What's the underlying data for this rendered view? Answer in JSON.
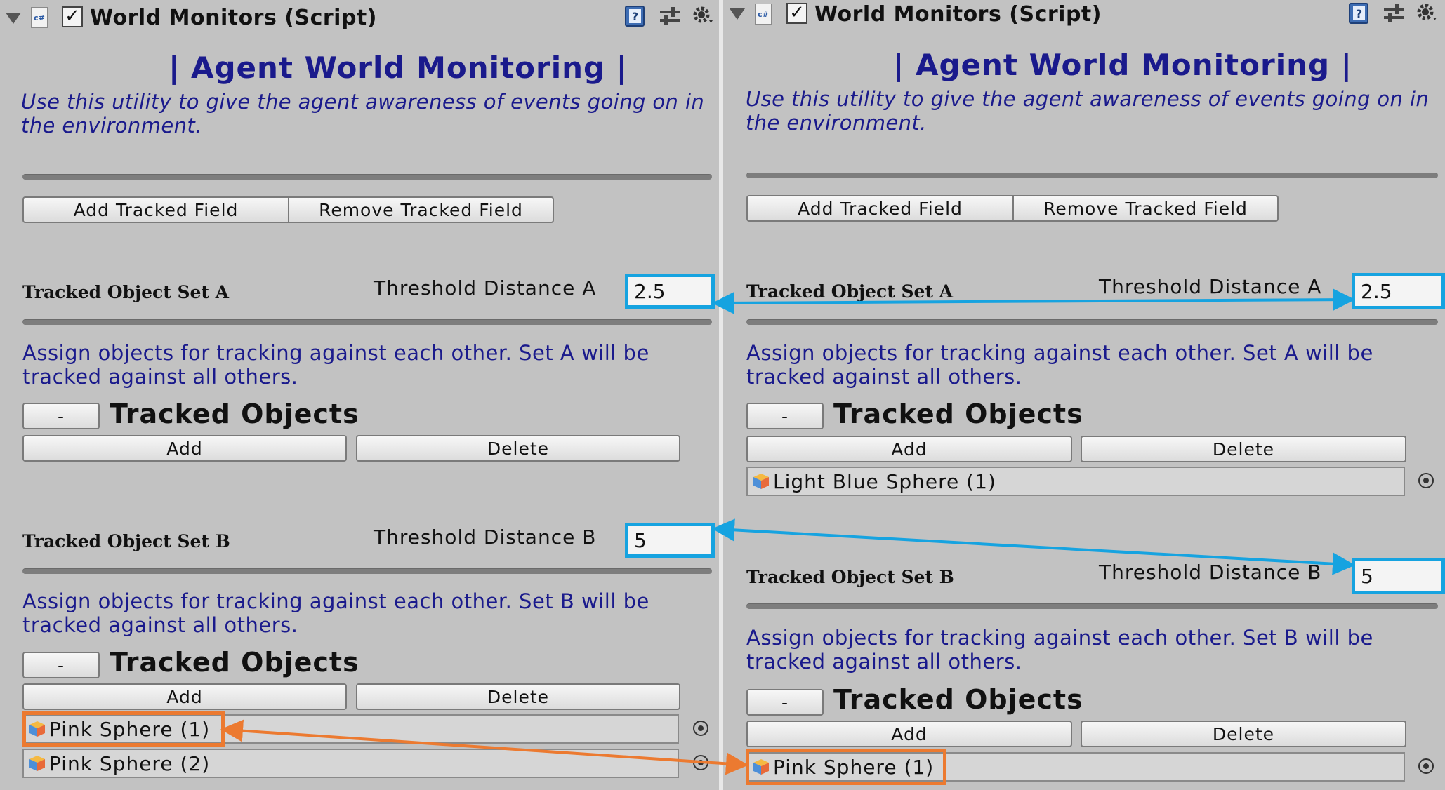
{
  "component_title": "World Monitors (Script)",
  "script_icon_label": "c#",
  "main_title": "| Agent World Monitoring |",
  "description": "Use this utility to give the agent awareness of events going on in the environment.",
  "buttons": {
    "add_tracked_field": "Add Tracked Field",
    "remove_tracked_field": "Remove Tracked Field",
    "collapse": "-",
    "add": "Add",
    "delete": "Delete"
  },
  "set_a": {
    "label": "Tracked Object Set A",
    "threshold_label": "Threshold Distance A",
    "threshold_value": "2.5",
    "assign_text": "Assign objects for tracking against each other. Set A will be tracked against all others.",
    "tracked_title": "Tracked Objects"
  },
  "set_b": {
    "label": "Tracked Object Set B",
    "threshold_label": "Threshold Distance B",
    "threshold_value": "5",
    "assign_text": "Assign objects for tracking against each other. Set B will be tracked against all others.",
    "tracked_title": "Tracked Objects"
  },
  "left_panel": {
    "set_a_objects": [],
    "set_b_objects": [
      "Pink Sphere (1)",
      "Pink Sphere (2)"
    ]
  },
  "right_panel": {
    "set_a_objects": [
      "Light Blue Sphere (1)"
    ],
    "set_b_objects": [
      "Pink Sphere (1)"
    ]
  },
  "icons": [
    "foldout-arrow-icon",
    "cs-script-icon",
    "enabled-checkbox",
    "help-book-icon",
    "preset-sliders-icon",
    "settings-gear-icon",
    "object-picker-icon",
    "cube-prefab-icon"
  ],
  "colors": {
    "background": "#c2c2c2",
    "title_text": "#1a1a8c",
    "highlight_blue": "#16a3e0",
    "highlight_orange": "#ec7a30"
  }
}
